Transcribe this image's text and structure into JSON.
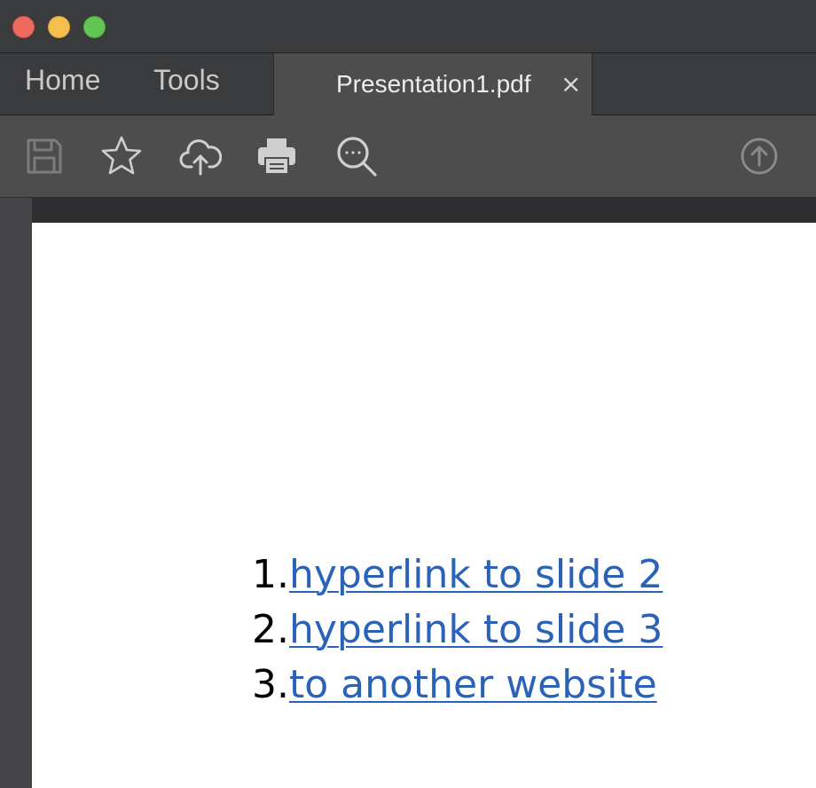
{
  "window": {
    "traffic_lights": [
      {
        "name": "close",
        "color": "#ed6a5e"
      },
      {
        "name": "minimize",
        "color": "#f5bf4f"
      },
      {
        "name": "maximize",
        "color": "#62c554"
      }
    ]
  },
  "tabs": {
    "home": "Home",
    "tools": "Tools",
    "document": {
      "label": "Presentation1.pdf",
      "close": "×"
    }
  },
  "toolbar": {
    "icons": [
      "save-icon",
      "bookmark-star-icon",
      "upload-cloud-icon",
      "print-icon",
      "search-more-icon",
      "scroll-up-icon"
    ]
  },
  "document": {
    "links": [
      {
        "number": "1.",
        "text": "hyperlink to slide 2"
      },
      {
        "number": "2.",
        "text": "hyperlink to slide 3"
      },
      {
        "number": "3.",
        "text": "to another website"
      }
    ],
    "link_color": "#2a62b8"
  }
}
